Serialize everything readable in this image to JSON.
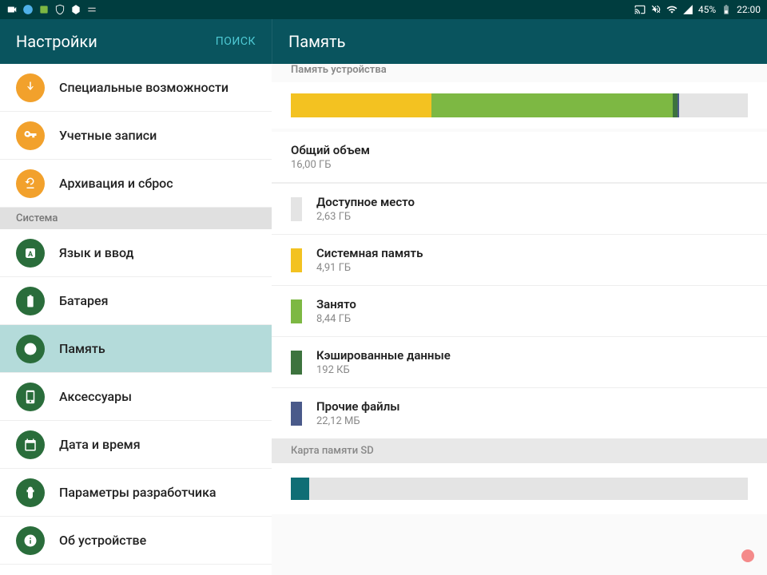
{
  "statusbar": {
    "battery_pct": "45%",
    "time": "22:00"
  },
  "header": {
    "left_title": "Настройки",
    "search_label": "ПОИСК",
    "right_title": "Память"
  },
  "sidebar": {
    "items_top": [
      {
        "label": "Специальные возможности",
        "icon": "hand",
        "color": "orange"
      },
      {
        "label": "Учетные записи",
        "icon": "key",
        "color": "orange"
      },
      {
        "label": "Архивация и сброс",
        "icon": "backup",
        "color": "orange"
      }
    ],
    "section_label": "Система",
    "items_system": [
      {
        "label": "Язык и ввод",
        "icon": "lang",
        "color": "green"
      },
      {
        "label": "Батарея",
        "icon": "battery",
        "color": "green"
      },
      {
        "label": "Память",
        "icon": "storage",
        "color": "green",
        "active": true
      },
      {
        "label": "Аксессуары",
        "icon": "accessory",
        "color": "green"
      },
      {
        "label": "Дата и время",
        "icon": "datetime",
        "color": "green"
      },
      {
        "label": "Параметры разработчика",
        "icon": "dev",
        "color": "green"
      },
      {
        "label": "Об устройстве",
        "icon": "about",
        "color": "green"
      }
    ]
  },
  "content": {
    "device_storage_header": "Память устройства",
    "total_label": "Общий объем",
    "total_value": "16,00 ГБ",
    "bar_segments": [
      {
        "color": "#f3c221",
        "pct": 30.7
      },
      {
        "color": "#7db843",
        "pct": 52.8
      },
      {
        "color": "#3d733e",
        "pct": 1.2
      },
      {
        "color": "#4a5a8a",
        "pct": 0.2
      },
      {
        "color": "#e4e4e4",
        "pct": 15.1
      }
    ],
    "rows": [
      {
        "label": "Доступное место",
        "value": "2,63 ГБ",
        "color": "#e4e4e4"
      },
      {
        "label": "Системная память",
        "value": "4,91 ГБ",
        "color": "#f3c221"
      },
      {
        "label": "Занято",
        "value": "8,44 ГБ",
        "color": "#7db843"
      },
      {
        "label": "Кэшированные данные",
        "value": "192 КБ",
        "color": "#3d733e"
      },
      {
        "label": "Прочие файлы",
        "value": "22,12 МБ",
        "color": "#4a5a8a"
      }
    ],
    "sd_header": "Карта памяти SD",
    "sd_bar": [
      {
        "color": "#0f6e75",
        "pct": 4
      },
      {
        "color": "#e4e4e4",
        "pct": 96
      }
    ]
  }
}
